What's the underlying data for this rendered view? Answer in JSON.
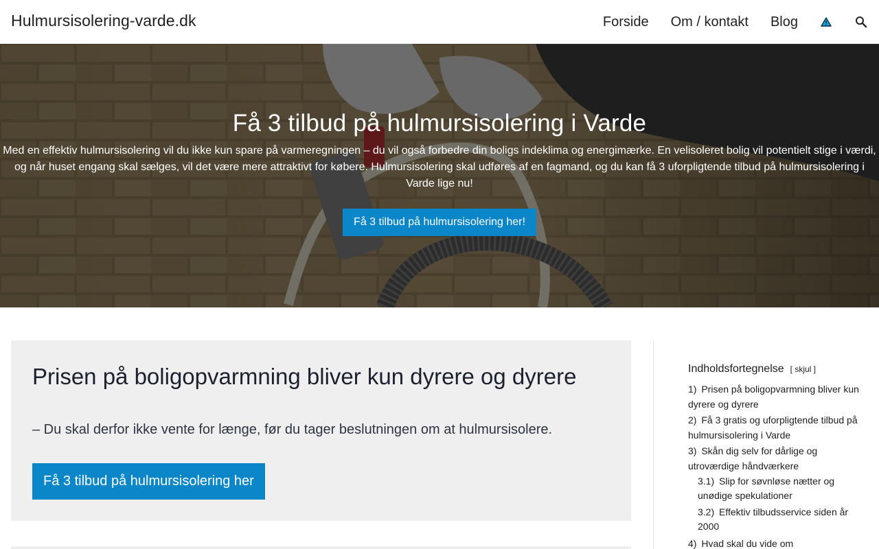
{
  "header": {
    "site_title": "Hulmursisolering-varde.dk",
    "nav": [
      {
        "label": "Forside"
      },
      {
        "label": "Om / kontakt"
      },
      {
        "label": "Blog"
      }
    ],
    "icons": [
      "warning-triangle-icon",
      "search-icon"
    ]
  },
  "hero": {
    "title": "Få 3 tilbud på hulmursisolering i Varde",
    "text": "Med en effektiv hulmursisolering vil du ikke kun spare på varmeregningen – du vil også forbedre din boligs indeklima og energimærke. En velisoleret bolig vil potentielt stige i værdi, og når huset engang skal sælges, vil det være mere attraktivt for købere. Hulmursisolering skal udføres af en fagmand, og du kan få 3 uforpligtende tilbud på hulmursisolering i Varde lige nu!",
    "button_label": "Få 3 tilbud på hulmursisolering her!"
  },
  "main": {
    "title": "Prisen på boligopvarmning bliver kun dyrere og dyrere",
    "subtitle": "– Du skal derfor ikke vente for længe, før du tager beslutningen om at hulmursisolere.",
    "button_label": "Få 3 tilbud på hulmursisolering her"
  },
  "toc": {
    "title": "Indholdsfortegnelse",
    "toggle_label": "[ skjul ]",
    "items": [
      {
        "num": "1)",
        "label": "Prisen på boligopvarmning bliver kun dyrere og dyrere",
        "level": 1
      },
      {
        "num": "2)",
        "label": "Få 3 gratis og uforpligtende tilbud på hulmursisolering i Varde",
        "level": 1
      },
      {
        "num": "3)",
        "label": "Skån dig selv for dårlige og utroværdige håndværkere",
        "level": 1
      },
      {
        "num": "3.1)",
        "label": "Slip for søvnløse nætter og unødige spekulationer",
        "level": 2
      },
      {
        "num": "3.2)",
        "label": "Effektiv tilbudsservice siden år 2000",
        "level": 2
      },
      {
        "num": "4)",
        "label": "Hvad skal du vide om",
        "level": 1
      }
    ]
  },
  "colors": {
    "accent": "#0a86c9",
    "content_bg": "#efefef",
    "warning_icon": "#1aa3d4"
  }
}
